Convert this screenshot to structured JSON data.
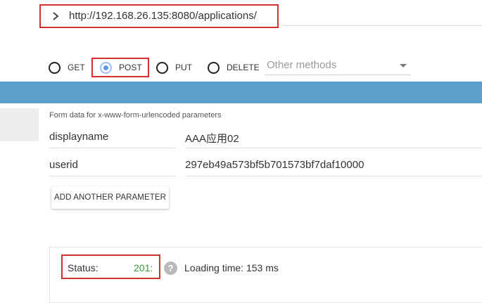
{
  "url": "http://192.168.26.135:8080/applications/",
  "methods": {
    "get": "GET",
    "post": "POST",
    "put": "PUT",
    "delete": "DELETE",
    "selected": "POST",
    "other_placeholder": "Other methods"
  },
  "form": {
    "caption": "Form data for x-www-form-urlencoded parameters",
    "params": [
      {
        "name": "displayname",
        "value": "AAA应用02"
      },
      {
        "name": "userid",
        "value": "297eb49a573bf5b701573bf7daf10000"
      }
    ],
    "add_button": "ADD ANOTHER PARAMETER"
  },
  "response": {
    "status_label": "Status:",
    "status_code": "201:",
    "help_icon": "?",
    "loading_time": "Loading time: 153 ms"
  },
  "colors": {
    "highlight": "#d32f2f",
    "bar": "#5b9fcb",
    "success": "#3a9a3a",
    "radio_selected": "#5c97e8"
  }
}
